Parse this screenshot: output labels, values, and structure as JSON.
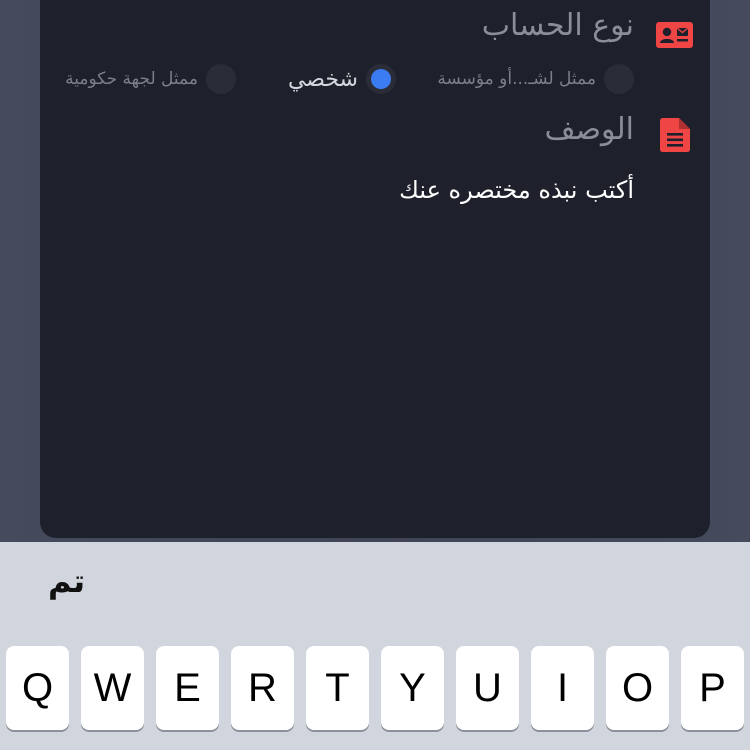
{
  "account_type": {
    "label": "نوع الحساب",
    "icon": "contact-card-icon",
    "options": [
      {
        "label": "ممثل لشـ...أو مؤسسة",
        "selected": false
      },
      {
        "label": "شخصي",
        "selected": true
      },
      {
        "label": "ممثل لجهة حكومية",
        "selected": false
      }
    ]
  },
  "description": {
    "label": "الوصف",
    "icon": "document-icon",
    "value": "أكتب نبذه مختصره عنك"
  },
  "keyboard_accessory": {
    "done_label": "تم"
  },
  "keyboard": {
    "keys": [
      "Q",
      "W",
      "E",
      "R",
      "T",
      "Y",
      "U",
      "I",
      "O",
      "P"
    ]
  },
  "colors": {
    "accent_icon": "#f04545",
    "radio_selected": "#3b7cf3",
    "card_background": "#1e202b"
  }
}
